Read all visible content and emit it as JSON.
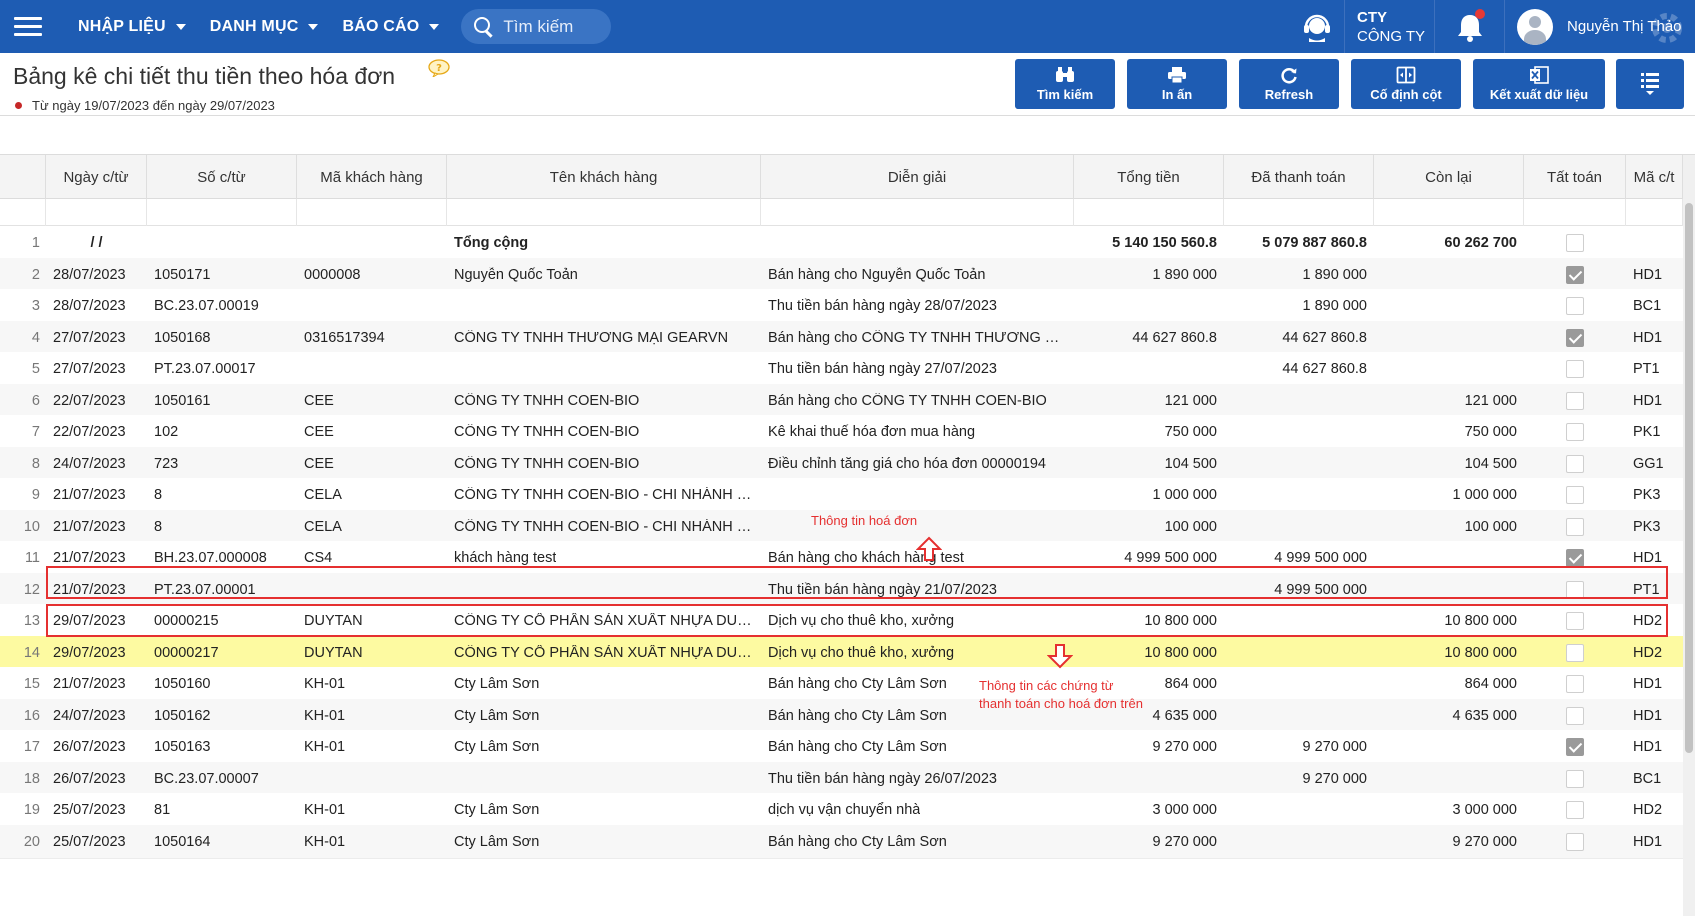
{
  "navbar": {
    "menus": [
      {
        "label": "NHẬP LIỆU"
      },
      {
        "label": "DANH MỤC"
      },
      {
        "label": "BÁO CÁO"
      }
    ],
    "search_placeholder": "Tìm kiếm",
    "company_line1": "CTY",
    "company_line2": "CÔNG TY",
    "user_name": "Nguyễn Thị Thảo"
  },
  "page": {
    "title": "Bảng kê chi tiết thu tiền theo hóa đơn",
    "date_range": "Từ ngày 19/07/2023 đến ngày 29/07/2023"
  },
  "toolbar": {
    "search": "Tìm kiếm",
    "print": "In ấn",
    "refresh": "Refresh",
    "freeze": "Cố định cột",
    "export": "Kết xuất dữ liệu"
  },
  "table": {
    "columns": [
      "Ngày c/từ",
      "Số c/từ",
      "Mã khách hàng",
      "Tên khách hàng",
      "Diễn giải",
      "Tổng tiền",
      "Đã thanh toán",
      "Còn lại",
      "Tất toán",
      "Mã c/t"
    ],
    "total_row": {
      "num": "1",
      "date": "/ /",
      "label": "Tổng cộng",
      "tong_tien": "5 140 150 560.8",
      "da_thanh_toan": "5 079 887 860.8",
      "con_lai": "60 262 700"
    },
    "rows": [
      {
        "num": "2",
        "date": "28/07/2023",
        "doc": "1050171",
        "cust_code": "0000008",
        "cust_name": "Nguyễn Quốc Toản",
        "desc": "Bán hàng cho Nguyễn Quốc Toản",
        "total": "1 890 000",
        "paid": "1 890 000",
        "remain": "",
        "settled": true,
        "type": "HD1"
      },
      {
        "num": "3",
        "date": "28/07/2023",
        "doc": "BC.23.07.00019",
        "cust_code": "",
        "cust_name": "",
        "desc": "Thu tiền bán hàng ngày 28/07/2023",
        "total": "",
        "paid": "1 890 000",
        "remain": "",
        "settled": false,
        "type": "BC1"
      },
      {
        "num": "4",
        "date": "27/07/2023",
        "doc": "1050168",
        "cust_code": "0316517394",
        "cust_name": "CÔNG TY TNHH THƯƠNG MẠI GEARVN",
        "desc": "Bán hàng cho CÔNG TY TNHH THƯƠNG M...",
        "total": "44 627 860.8",
        "paid": "44 627 860.8",
        "remain": "",
        "settled": true,
        "type": "HD1"
      },
      {
        "num": "5",
        "date": "27/07/2023",
        "doc": "PT.23.07.00017",
        "cust_code": "",
        "cust_name": "",
        "desc": "Thu tiền bán hàng ngày 27/07/2023",
        "total": "",
        "paid": "44 627 860.8",
        "remain": "",
        "settled": false,
        "type": "PT1"
      },
      {
        "num": "6",
        "date": "22/07/2023",
        "doc": "1050161",
        "cust_code": "CEE",
        "cust_name": "CÔNG TY TNHH COEN-BIO",
        "desc": "Bán hàng cho CÔNG TY TNHH COEN-BIO",
        "total": "121 000",
        "paid": "",
        "remain": "121 000",
        "settled": false,
        "type": "HD1"
      },
      {
        "num": "7",
        "date": "22/07/2023",
        "doc": "102",
        "cust_code": "CEE",
        "cust_name": "CÔNG TY TNHH COEN-BIO",
        "desc": "Kê khai thuế hóa đơn mua hàng",
        "total": "750 000",
        "paid": "",
        "remain": "750 000",
        "settled": false,
        "type": "PK1"
      },
      {
        "num": "8",
        "date": "24/07/2023",
        "doc": "723",
        "cust_code": "CEE",
        "cust_name": "CÔNG TY TNHH COEN-BIO",
        "desc": "Điều chỉnh tăng giá cho hóa đơn 00000194",
        "total": "104 500",
        "paid": "",
        "remain": "104 500",
        "settled": false,
        "type": "GG1"
      },
      {
        "num": "9",
        "date": "21/07/2023",
        "doc": "8",
        "cust_code": "CELA",
        "cust_name": "CÔNG TY TNHH COEN-BIO - CHI NHÁNH L...",
        "desc": "",
        "total": "1 000 000",
        "paid": "",
        "remain": "1 000 000",
        "settled": false,
        "type": "PK3"
      },
      {
        "num": "10",
        "date": "21/07/2023",
        "doc": "8",
        "cust_code": "CELA",
        "cust_name": "CÔNG TY TNHH COEN-BIO - CHI NHÁNH L...",
        "desc": "",
        "total": "100 000",
        "paid": "",
        "remain": "100 000",
        "settled": false,
        "type": "PK3"
      },
      {
        "num": "11",
        "date": "21/07/2023",
        "doc": "BH.23.07.000008",
        "cust_code": "CS4",
        "cust_name": "khách hàng test",
        "desc": "Bán hàng cho khách hàng test",
        "total": "4 999 500 000",
        "paid": "4 999 500 000",
        "remain": "",
        "settled": true,
        "type": "HD1"
      },
      {
        "num": "12",
        "date": "21/07/2023",
        "doc": "PT.23.07.00001",
        "cust_code": "",
        "cust_name": "",
        "desc": "Thu tiền bán hàng ngày 21/07/2023",
        "total": "",
        "paid": "4 999 500 000",
        "remain": "",
        "settled": false,
        "type": "PT1"
      },
      {
        "num": "13",
        "date": "29/07/2023",
        "doc": "00000215",
        "cust_code": "DUYTAN",
        "cust_name": "CÔNG TY CỔ PHẦN SẢN XUẤT NHỰA DUY...",
        "desc": "Dịch vụ cho thuê kho, xưởng",
        "total": "10 800 000",
        "paid": "",
        "remain": "10 800 000",
        "settled": false,
        "type": "HD2"
      },
      {
        "num": "14",
        "date": "29/07/2023",
        "doc": "00000217",
        "cust_code": "DUYTAN",
        "cust_name": "CÔNG TY CỔ PHẦN SẢN XUẤT NHỰA DUY...",
        "desc": "Dịch vụ cho thuê kho, xưởng",
        "total": "10 800 000",
        "paid": "",
        "remain": "10 800 000",
        "settled": false,
        "type": "HD2"
      },
      {
        "num": "15",
        "date": "21/07/2023",
        "doc": "1050160",
        "cust_code": "KH-01",
        "cust_name": "Cty Lâm Sơn",
        "desc": "Bán hàng cho Cty Lâm Sơn",
        "total": "864 000",
        "paid": "",
        "remain": "864 000",
        "settled": false,
        "type": "HD1"
      },
      {
        "num": "16",
        "date": "24/07/2023",
        "doc": "1050162",
        "cust_code": "KH-01",
        "cust_name": "Cty Lâm Sơn",
        "desc": "Bán hàng cho Cty Lâm Sơn",
        "total": "4 635 000",
        "paid": "",
        "remain": "4 635 000",
        "settled": false,
        "type": "HD1"
      },
      {
        "num": "17",
        "date": "26/07/2023",
        "doc": "1050163",
        "cust_code": "KH-01",
        "cust_name": "Cty Lâm Sơn",
        "desc": "Bán hàng cho Cty Lâm Sơn",
        "total": "9 270 000",
        "paid": "9 270 000",
        "remain": "",
        "settled": true,
        "type": "HD1"
      },
      {
        "num": "18",
        "date": "26/07/2023",
        "doc": "BC.23.07.00007",
        "cust_code": "",
        "cust_name": "",
        "desc": "Thu tiền bán hàng ngày 26/07/2023",
        "total": "",
        "paid": "9 270 000",
        "remain": "",
        "settled": false,
        "type": "BC1"
      },
      {
        "num": "19",
        "date": "25/07/2023",
        "doc": "81",
        "cust_code": "KH-01",
        "cust_name": "Cty Lâm Sơn",
        "desc": "dịch vụ vận chuyển nhà",
        "total": "3 000 000",
        "paid": "",
        "remain": "3 000 000",
        "settled": false,
        "type": "HD2"
      },
      {
        "num": "20",
        "date": "25/07/2023",
        "doc": "1050164",
        "cust_code": "KH-01",
        "cust_name": "Cty Lâm Sơn",
        "desc": "Bán hàng cho Cty Lâm Sơn",
        "total": "9 270 000",
        "paid": "",
        "remain": "9 270 000",
        "settled": false,
        "type": "HD1"
      }
    ],
    "highlight_row_index": 12
  },
  "annotations": {
    "invoice_info": "Thông tin hoá đơn",
    "payment_info": "Thông tin các chứng từ thanh toán cho hoá đơn trên"
  },
  "colors": {
    "primary": "#1e5cb3",
    "highlight": "#fdfaa1",
    "annotation": "#e53030"
  }
}
